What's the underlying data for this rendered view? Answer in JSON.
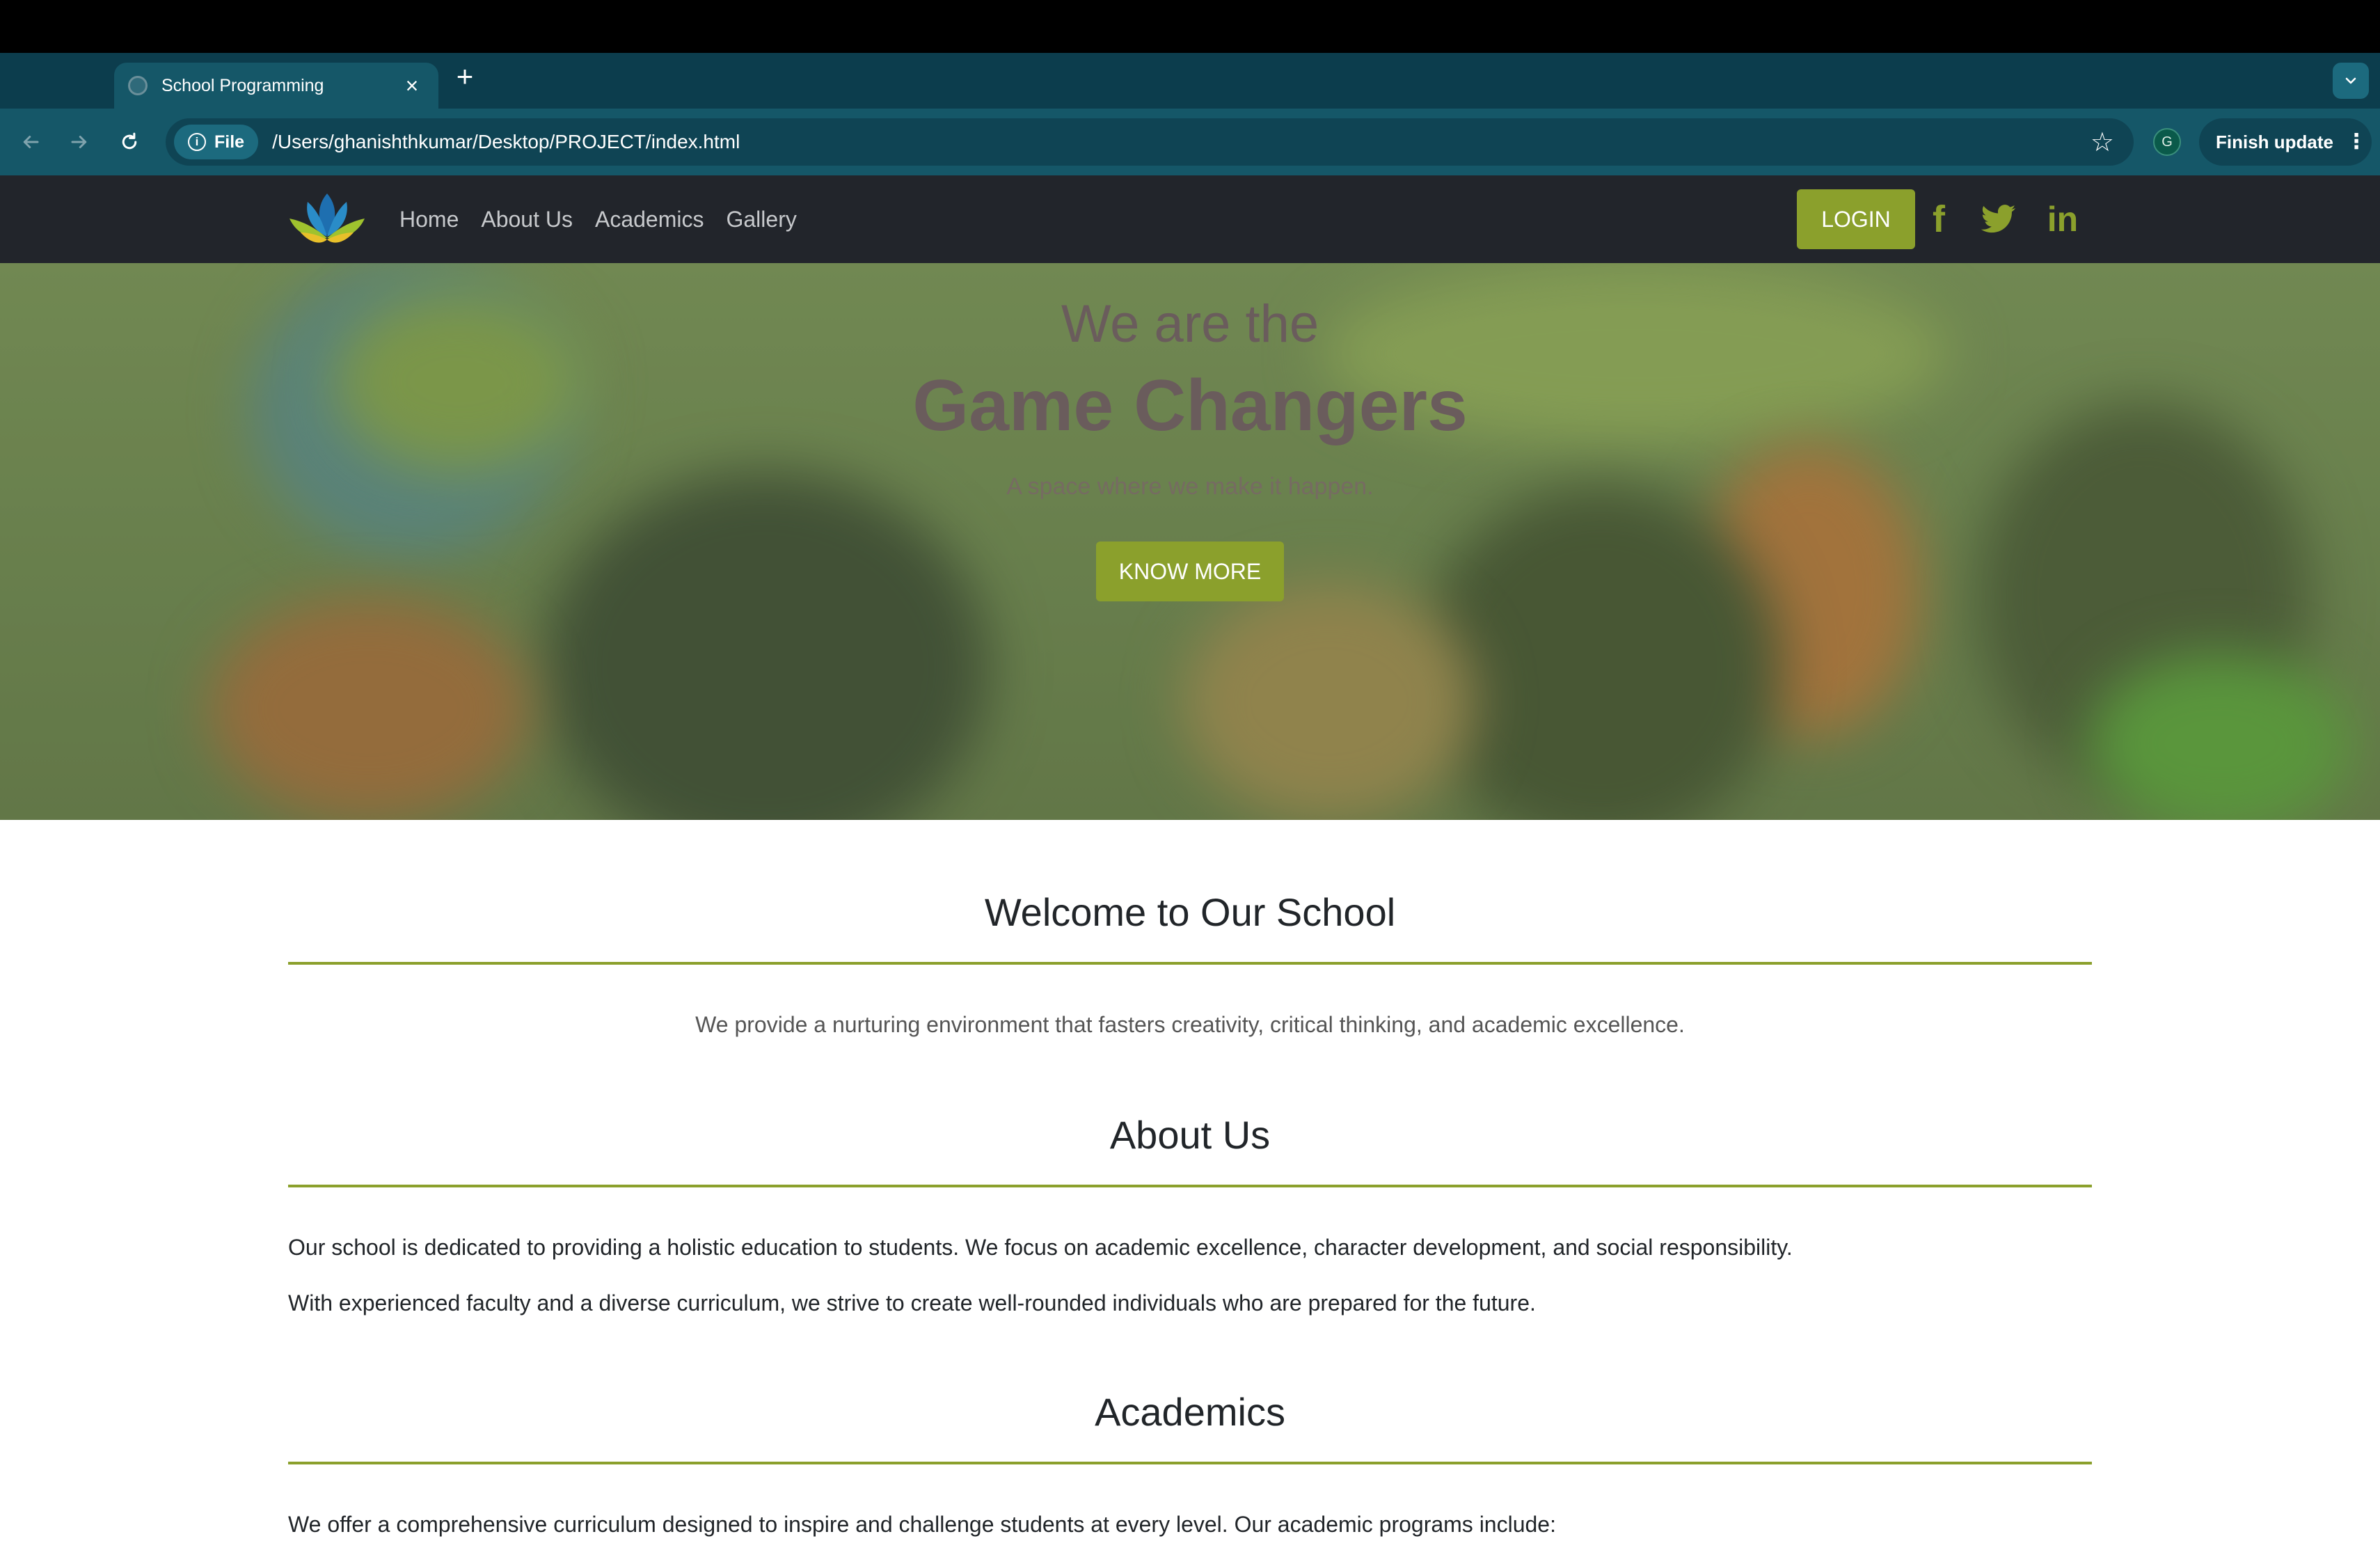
{
  "browser": {
    "tab_title": "School Programming",
    "tab_close": "×",
    "new_tab": "+",
    "file_chip": "File",
    "url": "/Users/ghanishthkumar/Desktop/PROJECT/index.html",
    "profile_initial": "G",
    "finish_update": "Finish update"
  },
  "nav": {
    "items": [
      "Home",
      "About Us",
      "Academics",
      "Gallery"
    ],
    "login": "LOGIN",
    "social": [
      "facebook-icon",
      "twitter-icon",
      "linkedin-icon"
    ],
    "facebook_glyph": "f",
    "linkedin_glyph": "in"
  },
  "hero": {
    "pre_title": "We are the",
    "title": "Game Changers",
    "subtitle": "A space where we make it happen.",
    "button": "KNOW MORE"
  },
  "sections": {
    "welcome": {
      "title": "Welcome to Our School",
      "text": "We provide a nurturing environment that fasters creativity, critical thinking, and academic excellence."
    },
    "about": {
      "title": "About Us",
      "p1": "Our school is dedicated to providing a holistic education to students. We focus on academic excellence, character development, and social responsibility.",
      "p2": "With experienced faculty and a diverse curriculum, we strive to create well-rounded individuals who are prepared for the future."
    },
    "academics": {
      "title": "Academics",
      "p1": "We offer a comprehensive curriculum designed to inspire and challenge students at every level. Our academic programs include:"
    }
  },
  "colors": {
    "accent": "#8ba02c",
    "nav_bg": "#22252b",
    "browser_frame": "#0c3d4d",
    "browser_toolbar": "#155768"
  }
}
